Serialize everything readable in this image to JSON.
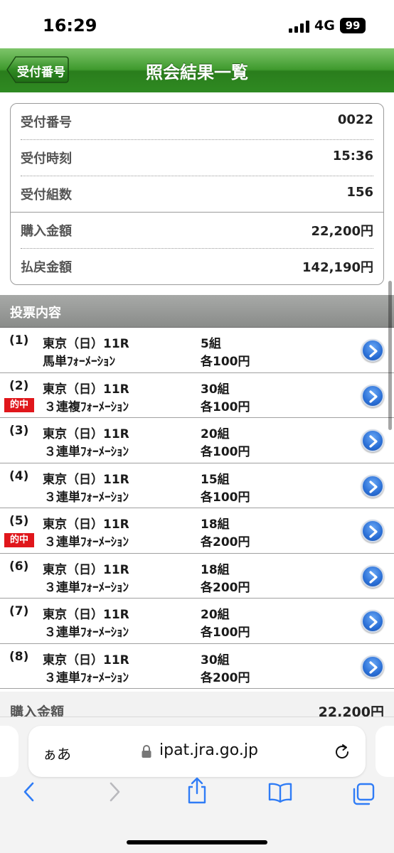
{
  "status_bar": {
    "time": "16:29",
    "network": "4G",
    "battery": "99"
  },
  "header": {
    "back_label": "受付番号",
    "title": "照会結果一覧"
  },
  "summary": {
    "rows": [
      {
        "label": "受付番号",
        "value": "0022"
      },
      {
        "label": "受付時刻",
        "value": "15:36"
      },
      {
        "label": "受付組数",
        "value": "156"
      },
      {
        "label": "購入金額",
        "value": "22,200円"
      },
      {
        "label": "払戻金額",
        "value": "142,190円"
      }
    ]
  },
  "section_title": "投票内容",
  "hit_label": "的中",
  "bets": [
    {
      "no": "(1)",
      "race": "東京（日）11R",
      "type": "馬単ﾌｫｰﾒｰｼｮﾝ",
      "count": "5組",
      "amount": "各100円",
      "hit": false
    },
    {
      "no": "(2)",
      "race": "東京（日）11R",
      "type": "３連複ﾌｫｰﾒｰｼｮﾝ",
      "count": "30組",
      "amount": "各100円",
      "hit": true
    },
    {
      "no": "(3)",
      "race": "東京（日）11R",
      "type": "３連単ﾌｫｰﾒｰｼｮﾝ",
      "count": "20組",
      "amount": "各100円",
      "hit": false
    },
    {
      "no": "(4)",
      "race": "東京（日）11R",
      "type": "３連単ﾌｫｰﾒｰｼｮﾝ",
      "count": "15組",
      "amount": "各100円",
      "hit": false
    },
    {
      "no": "(5)",
      "race": "東京（日）11R",
      "type": "３連単ﾌｫｰﾒｰｼｮﾝ",
      "count": "18組",
      "amount": "各200円",
      "hit": true
    },
    {
      "no": "(6)",
      "race": "東京（日）11R",
      "type": "３連単ﾌｫｰﾒｰｼｮﾝ",
      "count": "18組",
      "amount": "各200円",
      "hit": false
    },
    {
      "no": "(7)",
      "race": "東京（日）11R",
      "type": "３連単ﾌｫｰﾒｰｼｮﾝ",
      "count": "20組",
      "amount": "各100円",
      "hit": false
    },
    {
      "no": "(8)",
      "race": "東京（日）11R",
      "type": "３連単ﾌｫｰﾒｰｼｮﾝ",
      "count": "30組",
      "amount": "各200円",
      "hit": false
    }
  ],
  "bottom_total": {
    "label": "購入金額",
    "value": "22,200円"
  },
  "browser": {
    "aa_label": "ぁあ",
    "url": "ipat.jra.go.jp"
  },
  "colors": {
    "header_green": "#2f8a22",
    "hit_red": "#e0161b",
    "go_blue": "#2a6fd6"
  }
}
